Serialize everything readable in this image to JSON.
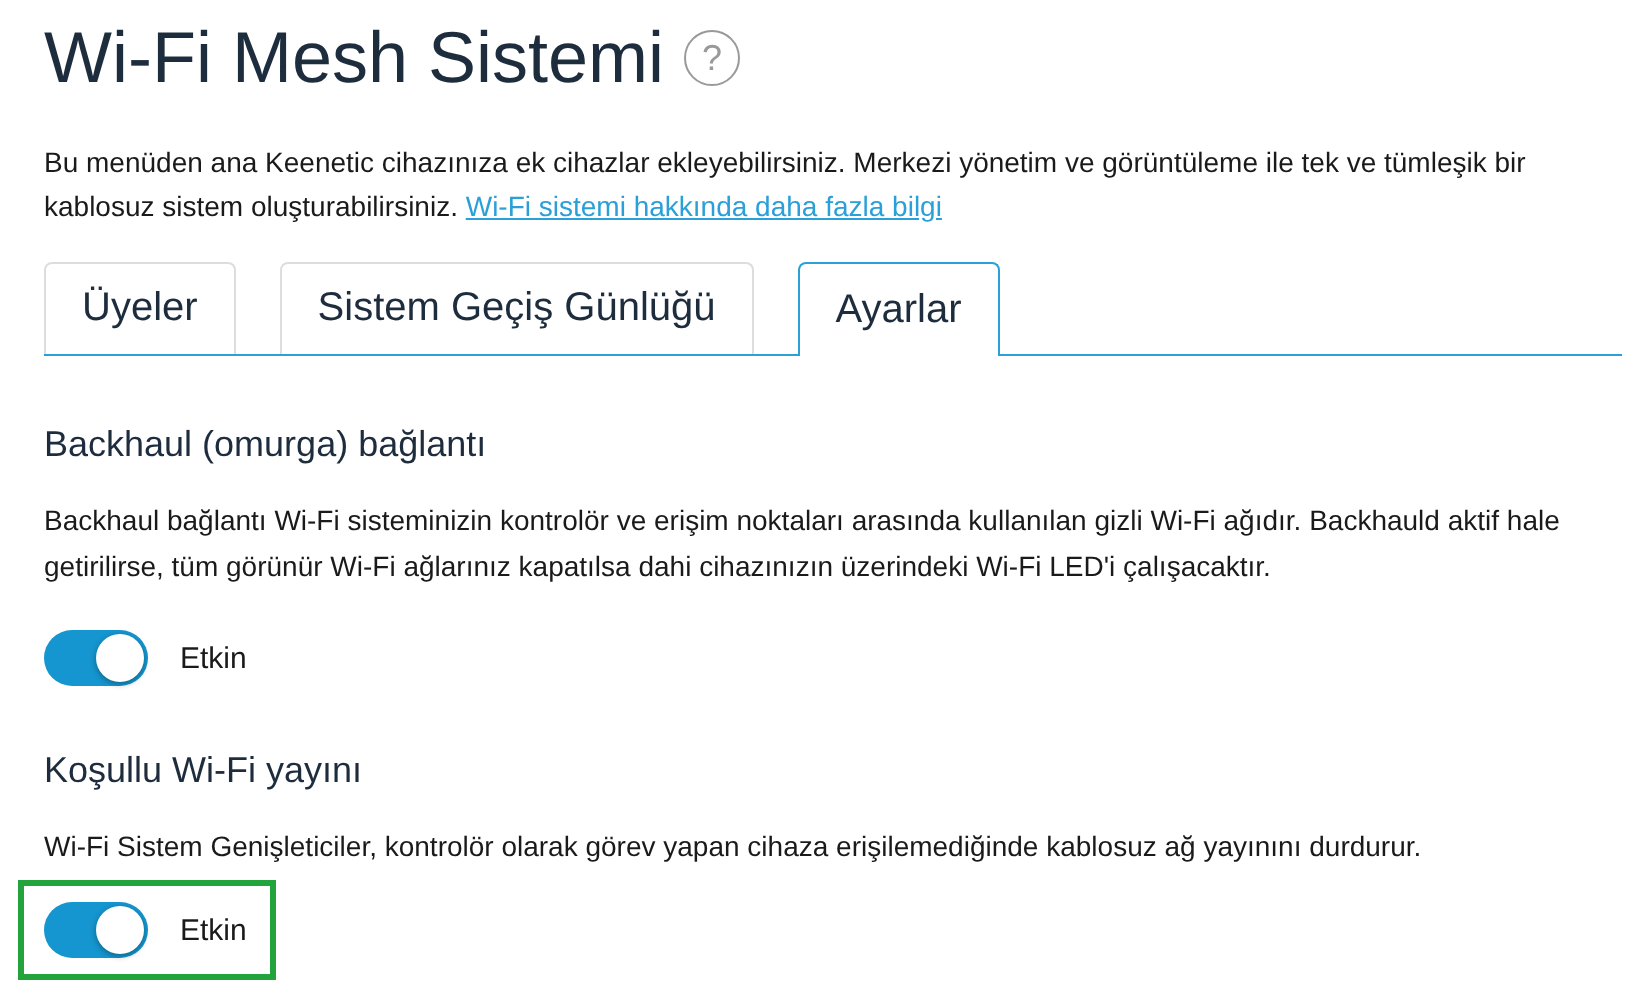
{
  "title": "Wi-Fi Mesh Sistemi",
  "help_icon": "?",
  "description": "Bu menüden ana Keenetic cihazınıza ek cihazlar ekleyebilirsiniz. Merkezi yönetim ve görüntüleme ile tek ve tümleşik bir kablosuz sistem oluşturabilirsiniz.",
  "description_link": "Wi-Fi sistemi hakkında daha fazla bilgi",
  "tabs": [
    {
      "label": "Üyeler",
      "selected": false
    },
    {
      "label": "Sistem Geçiş Günlüğü",
      "selected": false
    },
    {
      "label": "Ayarlar",
      "selected": true
    }
  ],
  "sections": [
    {
      "heading": "Backhaul (omurga) bağlantı",
      "text": "Backhaul bağlantı Wi-Fi sisteminizin kontrolör ve erişim noktaları arasında kullanılan gizli Wi-Fi ağıdır. Backhauld aktif hale getirilirse, tüm görünür Wi-Fi ağlarınız kapatılsa dahi cihazınızın üzerindeki Wi-Fi LED'i çalışacaktır.",
      "toggle": {
        "label": "Etkin",
        "on": true
      },
      "highlighted": false
    },
    {
      "heading": "Koşullu Wi-Fi yayını",
      "text": "Wi-Fi Sistem Genişleticiler, kontrolör olarak görev yapan cihaza erişilemediğinde kablosuz ağ yayınını durdurur.",
      "toggle": {
        "label": "Etkin",
        "on": true
      },
      "highlighted": true
    }
  ]
}
